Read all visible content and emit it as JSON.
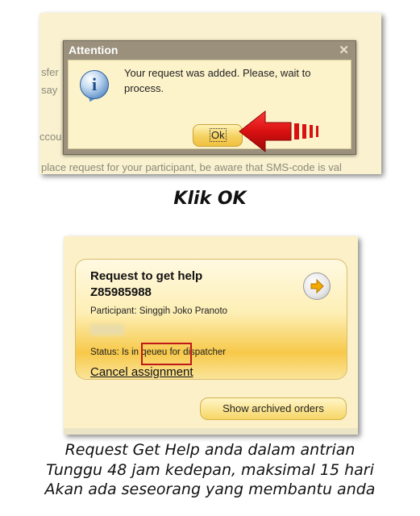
{
  "dialog": {
    "title": "Attention",
    "close_glyph": "✕",
    "message": "Your request was added. Please, wait to process.",
    "ok_label": "Ok",
    "icon": "info-icon"
  },
  "background_text": {
    "fragment_1": "sfer",
    "fragment_2": "say",
    "fragment_3": "ccou",
    "fragment_4": "place request for your participant, be aware that SMS-code is val"
  },
  "caption_top": "Klik OK",
  "request_card": {
    "title": "Request to get help",
    "id": "Z85985988",
    "participant": "Participant: Singgih Joko Pranoto",
    "status": "Status: Is in qeueu for dispatcher",
    "cancel_link": "Cancel assignment",
    "go_icon": "arrow-right-icon"
  },
  "archived_button": "Show archived orders",
  "caption_bottom": {
    "line1": "Request Get Help anda dalam antrian",
    "line2": "Tunggu 48 jam kedepan, maksimal 15 hari",
    "line3": "Akan ada seseorang yang membantu anda"
  },
  "colors": {
    "arrow_red": "#d81010",
    "highlight_red": "#c01818",
    "card_gold": "#f7c94a"
  }
}
